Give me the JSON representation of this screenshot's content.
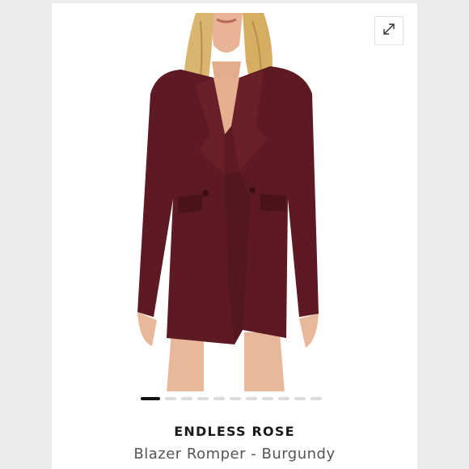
{
  "product": {
    "brand": "ENDLESS ROSE",
    "title": "Blazer Romper - Burgundy",
    "color_hex": "#5e1a22"
  },
  "gallery": {
    "image_count": 11,
    "active_index": 0,
    "expand_icon": "expand-arrows-icon"
  }
}
